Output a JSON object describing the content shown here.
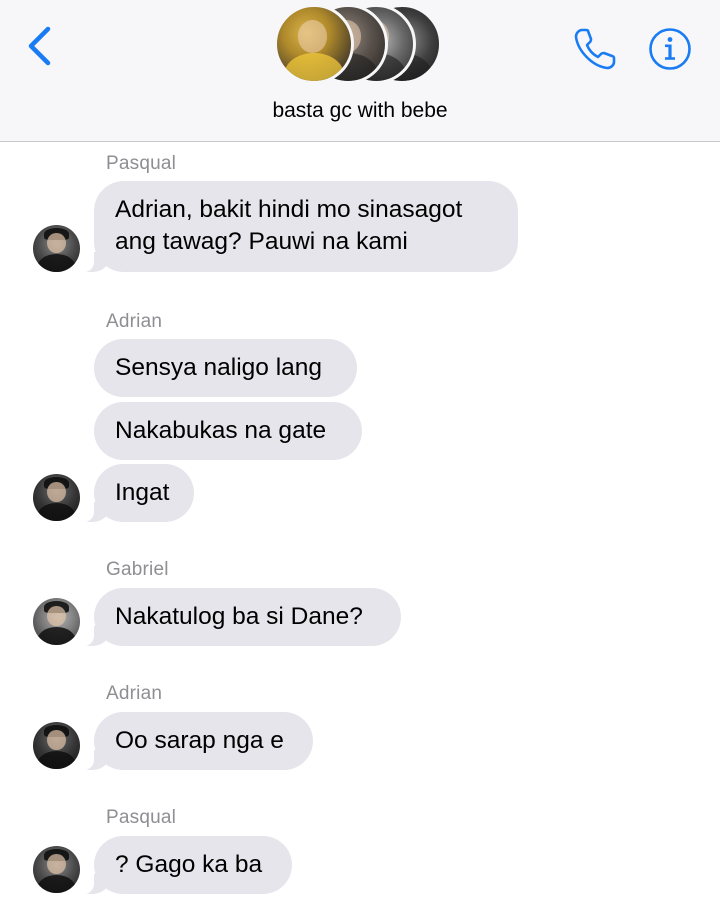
{
  "header": {
    "title": "basta gc with bebe",
    "icons": {
      "back": "chevron-left-icon",
      "call": "phone-icon",
      "info": "info-icon"
    },
    "accent_color": "#1a7cf5"
  },
  "messages": [
    {
      "sender": "Pasqual",
      "bubbles": [
        "Adrian, bakit hindi mo sinasagot",
        "ang tawag? Pauwi na kami"
      ]
    },
    {
      "sender": "Adrian",
      "bubbles": [
        "Sensya naligo lang",
        "Nakabukas na gate",
        "Ingat"
      ]
    },
    {
      "sender": "Gabriel",
      "bubbles": [
        "Nakatulog ba si Dane?"
      ]
    },
    {
      "sender": "Adrian",
      "bubbles": [
        "Oo sarap nga e"
      ]
    },
    {
      "sender": "Pasqual",
      "bubbles": [
        "? Gago ka ba"
      ]
    }
  ],
  "colors": {
    "bubble_bg": "#e6e5eb",
    "sender_name": "#8e8e93",
    "header_bg": "#f7f7f9"
  }
}
